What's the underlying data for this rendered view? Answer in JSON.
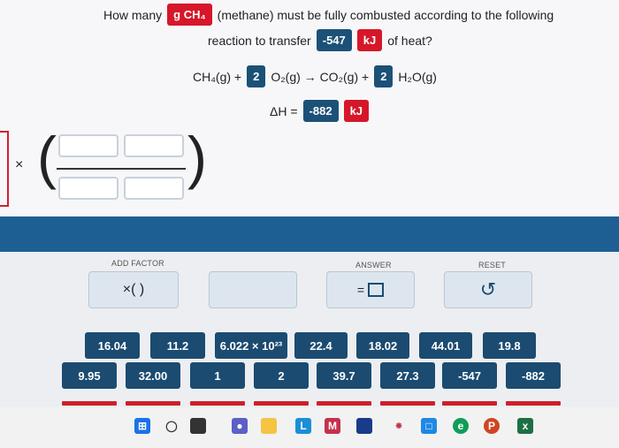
{
  "question": {
    "how_many": "How many",
    "unit_tag": "g CH₄",
    "substance": "(methane) must be fully combusted according to the following",
    "line2_prefix": "reaction to transfer",
    "heat_value": "-547",
    "heat_unit": "kJ",
    "line2_suffix": "of heat?"
  },
  "reaction": {
    "reactant1": "CH₄(g) +",
    "coef_o2": "2",
    "reactant2": "O₂(g) → CO₂(g) +",
    "coef_h2o": "2",
    "product2": "H₂O(g)"
  },
  "enthalpy": {
    "label": "ΔH =",
    "value": "-882",
    "unit": "kJ"
  },
  "expression": {
    "times_symbol": "×"
  },
  "controls": {
    "add_factor_label": "ADD FACTOR",
    "add_factor_text": "×( )",
    "answer_label": "ANSWER",
    "answer_text": "=",
    "reset_label": "RESET",
    "reset_icon": "↺"
  },
  "tiles_row1": [
    "16.04",
    "11.2",
    "6.022 × 10²³",
    "22.4",
    "18.02",
    "44.01",
    "19.8"
  ],
  "tiles_row2": [
    "9.95",
    "32.00",
    "1",
    "2",
    "39.7",
    "27.3",
    "-547",
    "-882"
  ],
  "colors": {
    "accent_blue": "#1b4b71",
    "accent_red": "#d6172a",
    "band_blue": "#1d5f93"
  },
  "taskbar_icons": [
    "windows-icon",
    "search-icon",
    "task-view-icon",
    "teams-chat-icon",
    "file-explorer-icon",
    "l-app-icon",
    "mail-icon",
    "store-icon",
    "network-icon",
    "photos-icon",
    "edge-icon",
    "powerpoint-icon",
    "excel-icon"
  ]
}
